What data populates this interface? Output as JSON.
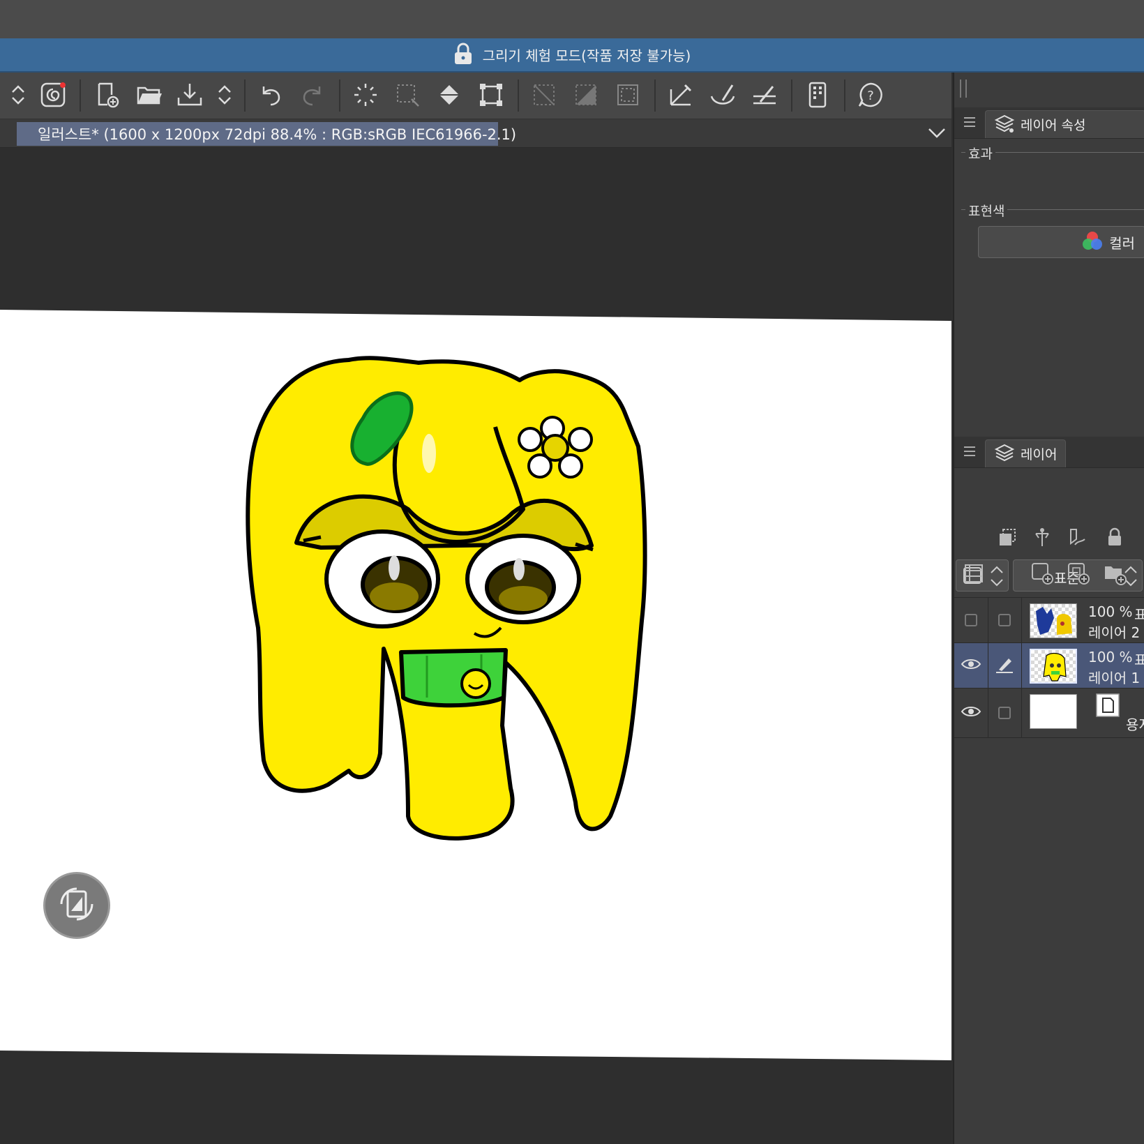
{
  "banner": {
    "text": "그리기 체험 모드(작품 저장 불가능)",
    "icon": "lock-icon"
  },
  "toolbar": {
    "icons": [
      "chevron-updown-icon",
      "cloud-services-icon",
      "new-file-icon",
      "open-folder-icon",
      "save-icon",
      "chevron-updown-icon",
      "undo-icon",
      "redo-icon",
      "select-all-icon",
      "deselect-icon",
      "fill-icon",
      "transform-icon",
      "clear-icon",
      "clear-outside-icon",
      "invert-selection-icon",
      "ruler-pen-icon",
      "ruler-curve-icon",
      "ruler-line-icon",
      "smartphone-icon",
      "help-icon"
    ]
  },
  "document_tab": {
    "title": "일러스트* (1600 x 1200px 72dpi 88.4% : RGB:sRGB IEC61966-2.1)"
  },
  "canvas": {
    "rotate_button_icon": "rotate-flip-icon"
  },
  "layer_property_panel": {
    "tab_label": "레이어 속성",
    "section_effect": "효과",
    "section_expression_color": "표현색",
    "color_button_label": "컬러"
  },
  "layer_panel": {
    "tab_label": "레이어",
    "blend_mode": "표준",
    "layers": [
      {
        "opacity": "100 %",
        "name": "레이어 2",
        "visible": false,
        "editing": false,
        "blend_fragment": "표"
      },
      {
        "opacity": "100 %",
        "name": "레이어 1",
        "visible": true,
        "editing": true,
        "blend_fragment": "표"
      },
      {
        "opacity": "",
        "name": "용지",
        "visible": true,
        "editing": false,
        "blend_fragment": ""
      }
    ]
  },
  "colors": {
    "banner": "#3a6a99",
    "selected_tab": "#5f6b87",
    "panel": "#3c3c3c",
    "canvas_paper": "#ffffff",
    "character_yellow": "#ffec00",
    "scarf_green": "#3ed23a"
  }
}
